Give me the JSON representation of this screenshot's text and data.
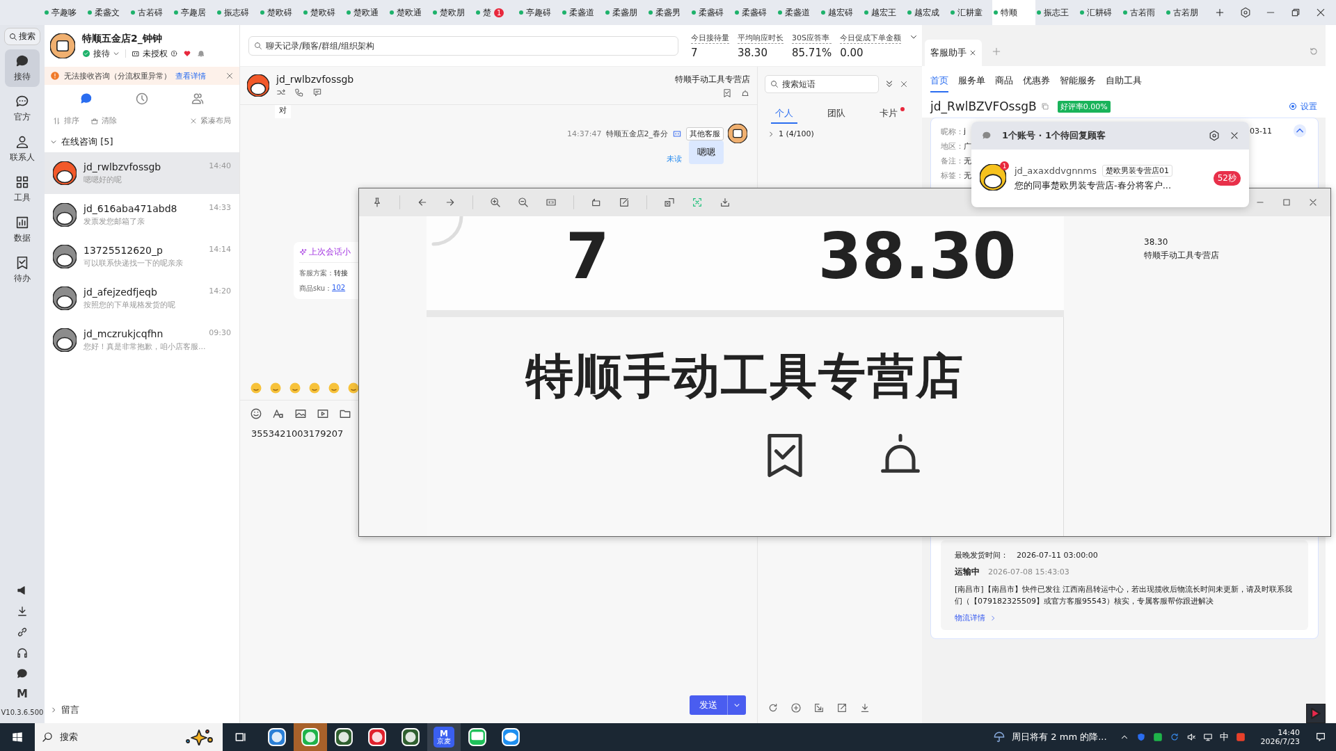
{
  "top_tabs": [
    {
      "label": "亭趣哆",
      "selected": false
    },
    {
      "label": "柔盏文",
      "selected": false
    },
    {
      "label": "古若碍",
      "selected": false
    },
    {
      "label": "亭趣居",
      "selected": false
    },
    {
      "label": "振志碍",
      "selected": false
    },
    {
      "label": "楚欧碍",
      "selected": false
    },
    {
      "label": "楚欧碍",
      "selected": false
    },
    {
      "label": "楚欧通",
      "selected": false
    },
    {
      "label": "楚欧通",
      "selected": false
    },
    {
      "label": "楚欧朋",
      "selected": false
    },
    {
      "label": "楚",
      "selected": false,
      "badge": "1"
    },
    {
      "label": "亭趣碍",
      "selected": false
    },
    {
      "label": "柔盏道",
      "selected": false
    },
    {
      "label": "柔盏朋",
      "selected": false
    },
    {
      "label": "柔盏男",
      "selected": false
    },
    {
      "label": "柔盏碍",
      "selected": false
    },
    {
      "label": "柔盏碍",
      "selected": false
    },
    {
      "label": "柔盏道",
      "selected": false
    },
    {
      "label": "越宏碍",
      "selected": false
    },
    {
      "label": "越宏王",
      "selected": false
    },
    {
      "label": "越宏成",
      "selected": false
    },
    {
      "label": "汇耕童",
      "selected": false
    },
    {
      "label": "特顺",
      "selected": true
    },
    {
      "label": "振志王",
      "selected": false
    },
    {
      "label": "汇耕碍",
      "selected": false
    },
    {
      "label": "古若雨",
      "selected": false
    },
    {
      "label": "古若朋",
      "selected": false
    }
  ],
  "rail": {
    "search": "搜索",
    "items": [
      {
        "label": "接待",
        "selected": true
      },
      {
        "label": "官方",
        "selected": false
      },
      {
        "label": "联系人",
        "selected": false
      },
      {
        "label": "工具",
        "selected": false
      },
      {
        "label": "数据",
        "selected": false
      },
      {
        "label": "待办",
        "selected": false
      }
    ],
    "logo": "M",
    "version": "V10.3.6.500"
  },
  "account": {
    "name": "特顺五金店2_钟钟",
    "status": "接待",
    "auth": "未授权"
  },
  "alert": {
    "text": "无法接收咨询（分流权重异常）",
    "link": "查看详情"
  },
  "list_tabs": [
    {
      "selected": true
    },
    {
      "selected": false
    },
    {
      "selected": false
    }
  ],
  "list_actions": [
    "排序",
    "清除",
    "紧凑布局"
  ],
  "online_group": {
    "label": "在线咨询 [5]",
    "expanded": true,
    "items": [
      {
        "name": "jd_rwlbzvfossgb",
        "time": "14:40",
        "preview": "嗯嗯好的呢",
        "selected": true
      },
      {
        "name": "jd_616aba471abd8",
        "time": "14:33",
        "preview": "发票发您邮箱了亲",
        "selected": false
      },
      {
        "name": "13725512620_p",
        "time": "14:14",
        "preview": "可以联系快递找一下的呢亲亲",
        "selected": false
      },
      {
        "name": "jd_afejzedfjeqb",
        "time": "14:20",
        "preview": "按照您的下单规格发货的呢",
        "selected": false
      },
      {
        "name": "jd_mczrukjcqfhn",
        "time": "09:30",
        "preview": "您好！真是非常抱歉，咱小店客服...",
        "selected": false
      }
    ]
  },
  "message_group": {
    "label": "留言",
    "expanded": false
  },
  "search": {
    "placeholder": "聊天记录/顾客/群组/组织架构"
  },
  "stats": [
    {
      "label": "今日接待量",
      "value": "7"
    },
    {
      "label": "平均响应时长",
      "value": "38.30"
    },
    {
      "label": "30S应答率",
      "value": "85.71%"
    },
    {
      "label": "今日促成下单金额",
      "value": "0.00"
    }
  ],
  "chat": {
    "name": "jd_rwlbzvfossgb",
    "store": "特顺手动工具专营店",
    "fragment": "对",
    "message": {
      "time": "14:37:47",
      "sender": "特顺五金店2_春分",
      "tag": "其他客服",
      "text": "嗯嗯",
      "status": "未读"
    },
    "summary": {
      "title": "上次会话小",
      "rows": [
        {
          "label": "客服方案：",
          "value": "转接",
          "link": false
        },
        {
          "label": "商品sku：",
          "value": "102",
          "link": true
        }
      ]
    },
    "draft": "3553421003179207",
    "send": "发送"
  },
  "phrases": {
    "placeholder": "搜索短语",
    "tabs": [
      {
        "label": "个人",
        "selected": true,
        "dot": false
      },
      {
        "label": "团队",
        "selected": false,
        "dot": false
      },
      {
        "label": "卡片",
        "selected": false,
        "dot": true
      }
    ],
    "tree": [
      {
        "label": "1 (4/100)",
        "expanded": false
      }
    ]
  },
  "assistant": {
    "tab": "客服助手",
    "subtabs": [
      {
        "label": "首页",
        "selected": true
      },
      {
        "label": "服务单",
        "selected": false
      },
      {
        "label": "商品",
        "selected": false
      },
      {
        "label": "优惠券",
        "selected": false
      },
      {
        "label": "智能服务",
        "selected": false
      },
      {
        "label": "自助工具",
        "selected": false
      }
    ],
    "customer": "jd_RwlBZVFOssgB",
    "rating": "好评率0.00%",
    "settings": {
      "label": "设置",
      "checked": true
    },
    "info": [
      {
        "label": "昵称：",
        "value": "j"
      },
      {
        "label": "地区：",
        "value": "广"
      },
      {
        "label": "备注：",
        "value": "无"
      },
      {
        "label": "标签：",
        "value": "无"
      }
    ],
    "date": "03-11",
    "shipping": {
      "label": "最晚发货时间：",
      "value": "2026-07-11 03:00:00"
    },
    "logistics": {
      "status": "运输中",
      "time": "2026-07-08 15:43:03",
      "text": "[南昌市]【南昌市】快件已发往 江西南昌转运中心，若出现揽收后物流长时间未更新，请及时联系我们（【079182325509】或官方客服95543）核实，专属客服帮你跟进解决",
      "link": "物流详情"
    }
  },
  "popup": {
    "title": "1个账号 · 1个待回复顾客",
    "item": {
      "name": "jd_axaxddvgnnms",
      "tag": "楚欧男装专营店01",
      "preview": "您的同事楚欧男装专营店-春分将客户...",
      "wait": "52秒",
      "unread": "1"
    }
  },
  "viewer": {
    "big_values": [
      "7",
      "38.30"
    ],
    "big_store": "特顺手动工具专营店",
    "side_values": [
      "38.30",
      "特顺手动工具专营店"
    ]
  },
  "taskbar": {
    "search": "搜索",
    "app_letter": "M",
    "app_caption": "京麦",
    "weather": "周日将有 2 mm 的降...",
    "ime": "中",
    "time": "14:40",
    "date": "2026/7/23"
  }
}
